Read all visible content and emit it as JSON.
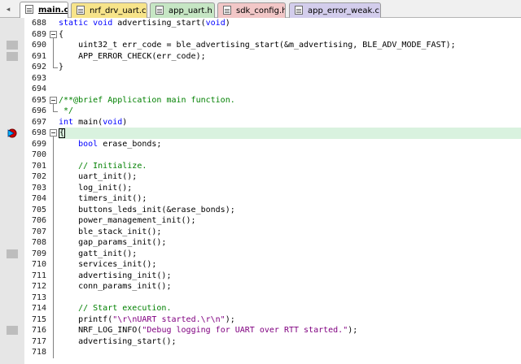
{
  "tabs": [
    {
      "label": "main.c",
      "active": true
    },
    {
      "label": "nrf_drv_uart.c",
      "active": false
    },
    {
      "label": "app_uart.h",
      "active": false
    },
    {
      "label": "sdk_config.h",
      "active": false
    },
    {
      "label": "app_error_weak.c",
      "active": false
    }
  ],
  "colors": {
    "current_line": "#d9f2df",
    "keyword": "#0000ff",
    "comment": "#008000",
    "string": "#800080"
  },
  "icons": {
    "tab_file": "file-icon",
    "breakpoint": "breakpoint-arrow-icon"
  },
  "editor": {
    "lines": [
      {
        "num": "688",
        "fold": "",
        "marker": false,
        "tokens": [
          [
            "kw",
            "static"
          ],
          [
            "t",
            " "
          ],
          [
            "kw",
            "void"
          ],
          [
            "t",
            " advertising_start("
          ],
          [
            "kw",
            "void"
          ],
          [
            "t",
            ")"
          ]
        ]
      },
      {
        "num": "689",
        "fold": "open",
        "marker": false,
        "tokens": [
          [
            "t",
            "{"
          ]
        ]
      },
      {
        "num": "690",
        "fold": "line",
        "marker": true,
        "tokens": [
          [
            "t",
            "    uint32_t err_code = ble_advertising_start(&m_advertising, BLE_ADV_MODE_FAST);"
          ]
        ]
      },
      {
        "num": "691",
        "fold": "line",
        "marker": true,
        "tokens": [
          [
            "t",
            "    APP_ERROR_CHECK(err_code);"
          ]
        ]
      },
      {
        "num": "692",
        "fold": "end",
        "marker": false,
        "tokens": [
          [
            "t",
            "}"
          ]
        ]
      },
      {
        "num": "693",
        "fold": "",
        "marker": false,
        "tokens": []
      },
      {
        "num": "694",
        "fold": "",
        "marker": false,
        "tokens": []
      },
      {
        "num": "695",
        "fold": "open",
        "marker": false,
        "tokens": [
          [
            "cm",
            "/**@brief Application main function."
          ]
        ]
      },
      {
        "num": "696",
        "fold": "end",
        "marker": false,
        "tokens": [
          [
            "cm",
            " */"
          ]
        ]
      },
      {
        "num": "697",
        "fold": "",
        "marker": false,
        "tokens": [
          [
            "kw",
            "int"
          ],
          [
            "t",
            " main("
          ],
          [
            "kw",
            "void"
          ],
          [
            "t",
            ")"
          ]
        ]
      },
      {
        "num": "698",
        "fold": "open",
        "marker": false,
        "breakpoint": true,
        "current": true,
        "tokens": [
          [
            "cur",
            "{"
          ]
        ]
      },
      {
        "num": "699",
        "fold": "line",
        "marker": false,
        "tokens": [
          [
            "t",
            "    "
          ],
          [
            "kw",
            "bool"
          ],
          [
            "t",
            " erase_bonds;"
          ]
        ]
      },
      {
        "num": "700",
        "fold": "line",
        "marker": false,
        "tokens": []
      },
      {
        "num": "701",
        "fold": "line",
        "marker": false,
        "tokens": [
          [
            "cm",
            "    // Initialize."
          ]
        ]
      },
      {
        "num": "702",
        "fold": "line",
        "marker": false,
        "tokens": [
          [
            "t",
            "    uart_init();"
          ]
        ]
      },
      {
        "num": "703",
        "fold": "line",
        "marker": false,
        "tokens": [
          [
            "t",
            "    log_init();"
          ]
        ]
      },
      {
        "num": "704",
        "fold": "line",
        "marker": false,
        "tokens": [
          [
            "t",
            "    timers_init();"
          ]
        ]
      },
      {
        "num": "705",
        "fold": "line",
        "marker": false,
        "tokens": [
          [
            "t",
            "    buttons_leds_init(&erase_bonds);"
          ]
        ]
      },
      {
        "num": "706",
        "fold": "line",
        "marker": false,
        "tokens": [
          [
            "t",
            "    power_management_init();"
          ]
        ]
      },
      {
        "num": "707",
        "fold": "line",
        "marker": false,
        "tokens": [
          [
            "t",
            "    ble_stack_init();"
          ]
        ]
      },
      {
        "num": "708",
        "fold": "line",
        "marker": false,
        "tokens": [
          [
            "t",
            "    gap_params_init();"
          ]
        ]
      },
      {
        "num": "709",
        "fold": "line",
        "marker": true,
        "tokens": [
          [
            "t",
            "    gatt_init();"
          ]
        ]
      },
      {
        "num": "710",
        "fold": "line",
        "marker": false,
        "tokens": [
          [
            "t",
            "    services_init();"
          ]
        ]
      },
      {
        "num": "711",
        "fold": "line",
        "marker": false,
        "tokens": [
          [
            "t",
            "    advertising_init();"
          ]
        ]
      },
      {
        "num": "712",
        "fold": "line",
        "marker": false,
        "tokens": [
          [
            "t",
            "    conn_params_init();"
          ]
        ]
      },
      {
        "num": "713",
        "fold": "line",
        "marker": false,
        "tokens": []
      },
      {
        "num": "714",
        "fold": "line",
        "marker": false,
        "tokens": [
          [
            "cm",
            "    // Start execution."
          ]
        ]
      },
      {
        "num": "715",
        "fold": "line",
        "marker": false,
        "tokens": [
          [
            "t",
            "    printf("
          ],
          [
            "st",
            "\"\\r\\nUART started.\\r\\n\""
          ],
          [
            "t",
            ");"
          ]
        ]
      },
      {
        "num": "716",
        "fold": "line",
        "marker": true,
        "tokens": [
          [
            "t",
            "    NRF_LOG_INFO("
          ],
          [
            "st",
            "\"Debug logging for UART over RTT started.\""
          ],
          [
            "t",
            ");"
          ]
        ]
      },
      {
        "num": "717",
        "fold": "line",
        "marker": false,
        "tokens": [
          [
            "t",
            "    advertising_start();"
          ]
        ]
      },
      {
        "num": "718",
        "fold": "line",
        "marker": false,
        "tokens": []
      }
    ]
  }
}
